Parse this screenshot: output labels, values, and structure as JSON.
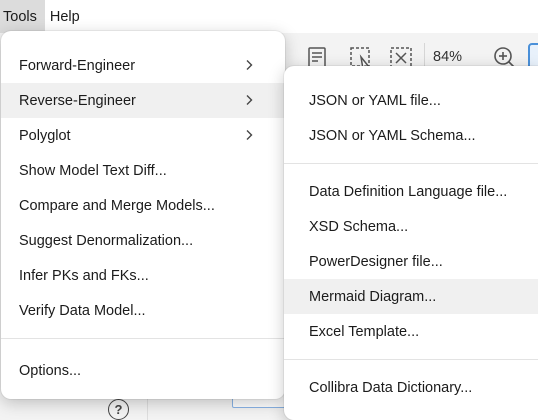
{
  "menubar": {
    "items": [
      {
        "label": "Tools"
      },
      {
        "label": "Help"
      }
    ]
  },
  "toolbar": {
    "zoom": "84%"
  },
  "tools_menu": {
    "items": [
      {
        "label": "Forward-Engineer"
      },
      {
        "label": "Reverse-Engineer"
      },
      {
        "label": "Polyglot"
      },
      {
        "label": "Show Model Text Diff..."
      },
      {
        "label": "Compare and Merge Models..."
      },
      {
        "label": "Suggest Denormalization..."
      },
      {
        "label": "Infer PKs and FKs..."
      },
      {
        "label": "Verify Data Model..."
      },
      {
        "label": "Options..."
      }
    ]
  },
  "reverse_engineer_menu": {
    "items": [
      {
        "label": "JSON or YAML file..."
      },
      {
        "label": "JSON or YAML Schema..."
      },
      {
        "label": "Data Definition Language file..."
      },
      {
        "label": "XSD Schema..."
      },
      {
        "label": "PowerDesigner file..."
      },
      {
        "label": "Mermaid Diagram..."
      },
      {
        "label": "Excel Template..."
      },
      {
        "label": "Collibra Data Dictionary..."
      }
    ]
  },
  "footer": {
    "help_glyph": "?"
  },
  "colors": {
    "highlight": "#f0f0f0",
    "menubar_active": "#dcdcdc",
    "accent": "#4a90d9"
  }
}
